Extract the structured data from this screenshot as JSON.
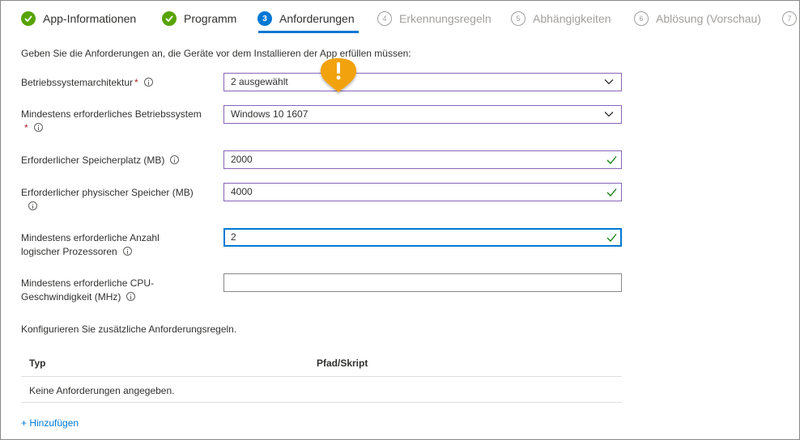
{
  "steps": [
    {
      "label": "App-Informationen",
      "state": "done",
      "num": ""
    },
    {
      "label": "Programm",
      "state": "done",
      "num": ""
    },
    {
      "label": "Anforderungen",
      "state": "current",
      "num": "3"
    },
    {
      "label": "Erkennungsregeln",
      "state": "todo",
      "num": "4"
    },
    {
      "label": "Abhängigkeiten",
      "state": "todo",
      "num": "5"
    },
    {
      "label": "Ablösung (Vorschau)",
      "state": "todo",
      "num": "6"
    },
    {
      "label": "",
      "state": "todo",
      "num": "7"
    }
  ],
  "intro": "Geben Sie die Anforderungen an, die Geräte vor dem Installieren der App erfüllen müssen:",
  "fields": {
    "architecture": {
      "label": "Betriebssystemarchitektur",
      "required": "*",
      "value": "2 ausgewählt"
    },
    "min_os": {
      "label": "Mindestens erforderliches Betriebssystem",
      "required": "*",
      "value": "Windows 10 1607"
    },
    "disk_space": {
      "label": "Erforderlicher Speicherplatz (MB)",
      "value": "2000"
    },
    "physical_memory": {
      "label": "Erforderlicher physischer Speicher (MB)",
      "value": "4000"
    },
    "processors": {
      "label_line1": "Mindestens erforderliche Anzahl",
      "label_line2": "logischer Prozessoren",
      "value": "2"
    },
    "cpu_speed": {
      "label_line1": "Mindestens erforderliche CPU-",
      "label_line2": "Geschwindigkeit (MHz)",
      "value": ""
    }
  },
  "additional_rules": {
    "text": "Konfigurieren Sie zusätzliche Anforderungsregeln.",
    "columns": [
      "Typ",
      "Pfad/Skript"
    ],
    "empty_text": "Keine Anforderungen angegeben.",
    "add_label": "+ Hinzufügen"
  },
  "colors": {
    "accent": "#0078d4",
    "done": "#57a300",
    "valid_border": "#8764b8",
    "required": "#a4262c",
    "warning": "#f2a20c"
  }
}
